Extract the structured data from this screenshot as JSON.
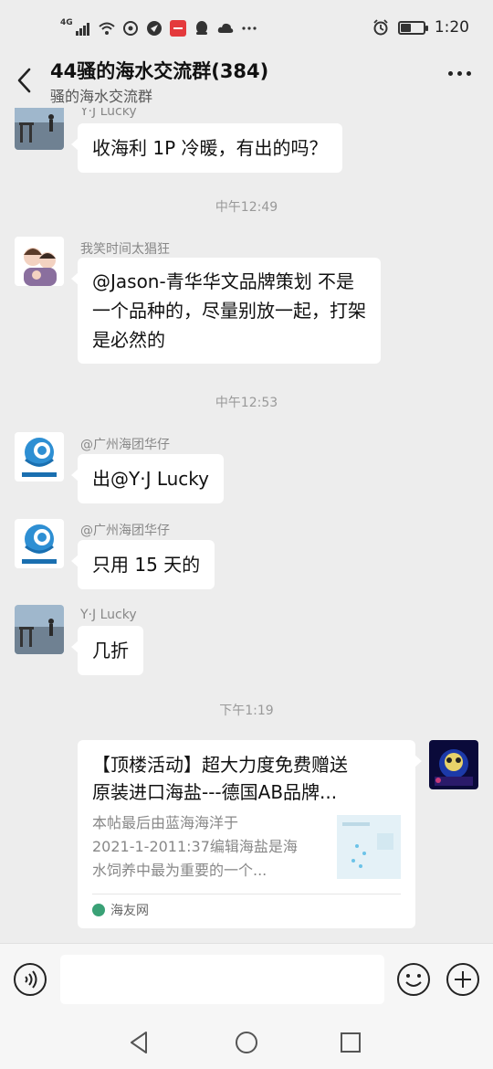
{
  "status_bar": {
    "network": "4G",
    "time": "1:20",
    "battery_level": 0.45
  },
  "header": {
    "title": "44骚的海水交流群(384)",
    "subtitle": "骚的海水交流群"
  },
  "messages": [
    {
      "sender": "Y·J Lucky",
      "text": "收海利 1P 冷暖，有出的吗？"
    },
    {
      "time": "中午12:49"
    },
    {
      "sender": "我笑时间太猖狂",
      "text_lines": [
        "@Jason-青华华文品牌策划  不是",
        "一个品种的，尽量别放一起，打架",
        "是必然的"
      ]
    },
    {
      "time": "中午12:53"
    },
    {
      "sender": "@广州海团华仔",
      "text": "出@Y·J Lucky"
    },
    {
      "sender": "@广州海团华仔",
      "text": "只用 15 天的"
    },
    {
      "sender": "Y·J Lucky",
      "text": "几折"
    },
    {
      "time": "下午1:19"
    }
  ],
  "link_card": {
    "title_lines": [
      "【顶楼活动】超大力度免费赠送",
      "原装进口海盐---德国AB品牌..."
    ],
    "desc_lines": [
      "本帖最后由蓝海海洋于",
      "2021-1-2011:37编辑海盐是海",
      "水饲养中最为重要的一个..."
    ],
    "source": "海友网"
  },
  "input": {
    "placeholder": ""
  },
  "icons": {
    "back": "back-arrow-icon",
    "more": "more-icon",
    "voice": "voice-icon",
    "emoji": "emoji-icon",
    "plus": "plus-icon"
  },
  "colors": {
    "background": "#ededed",
    "bubble": "#ffffff",
    "source_icon": "#3aa176"
  }
}
